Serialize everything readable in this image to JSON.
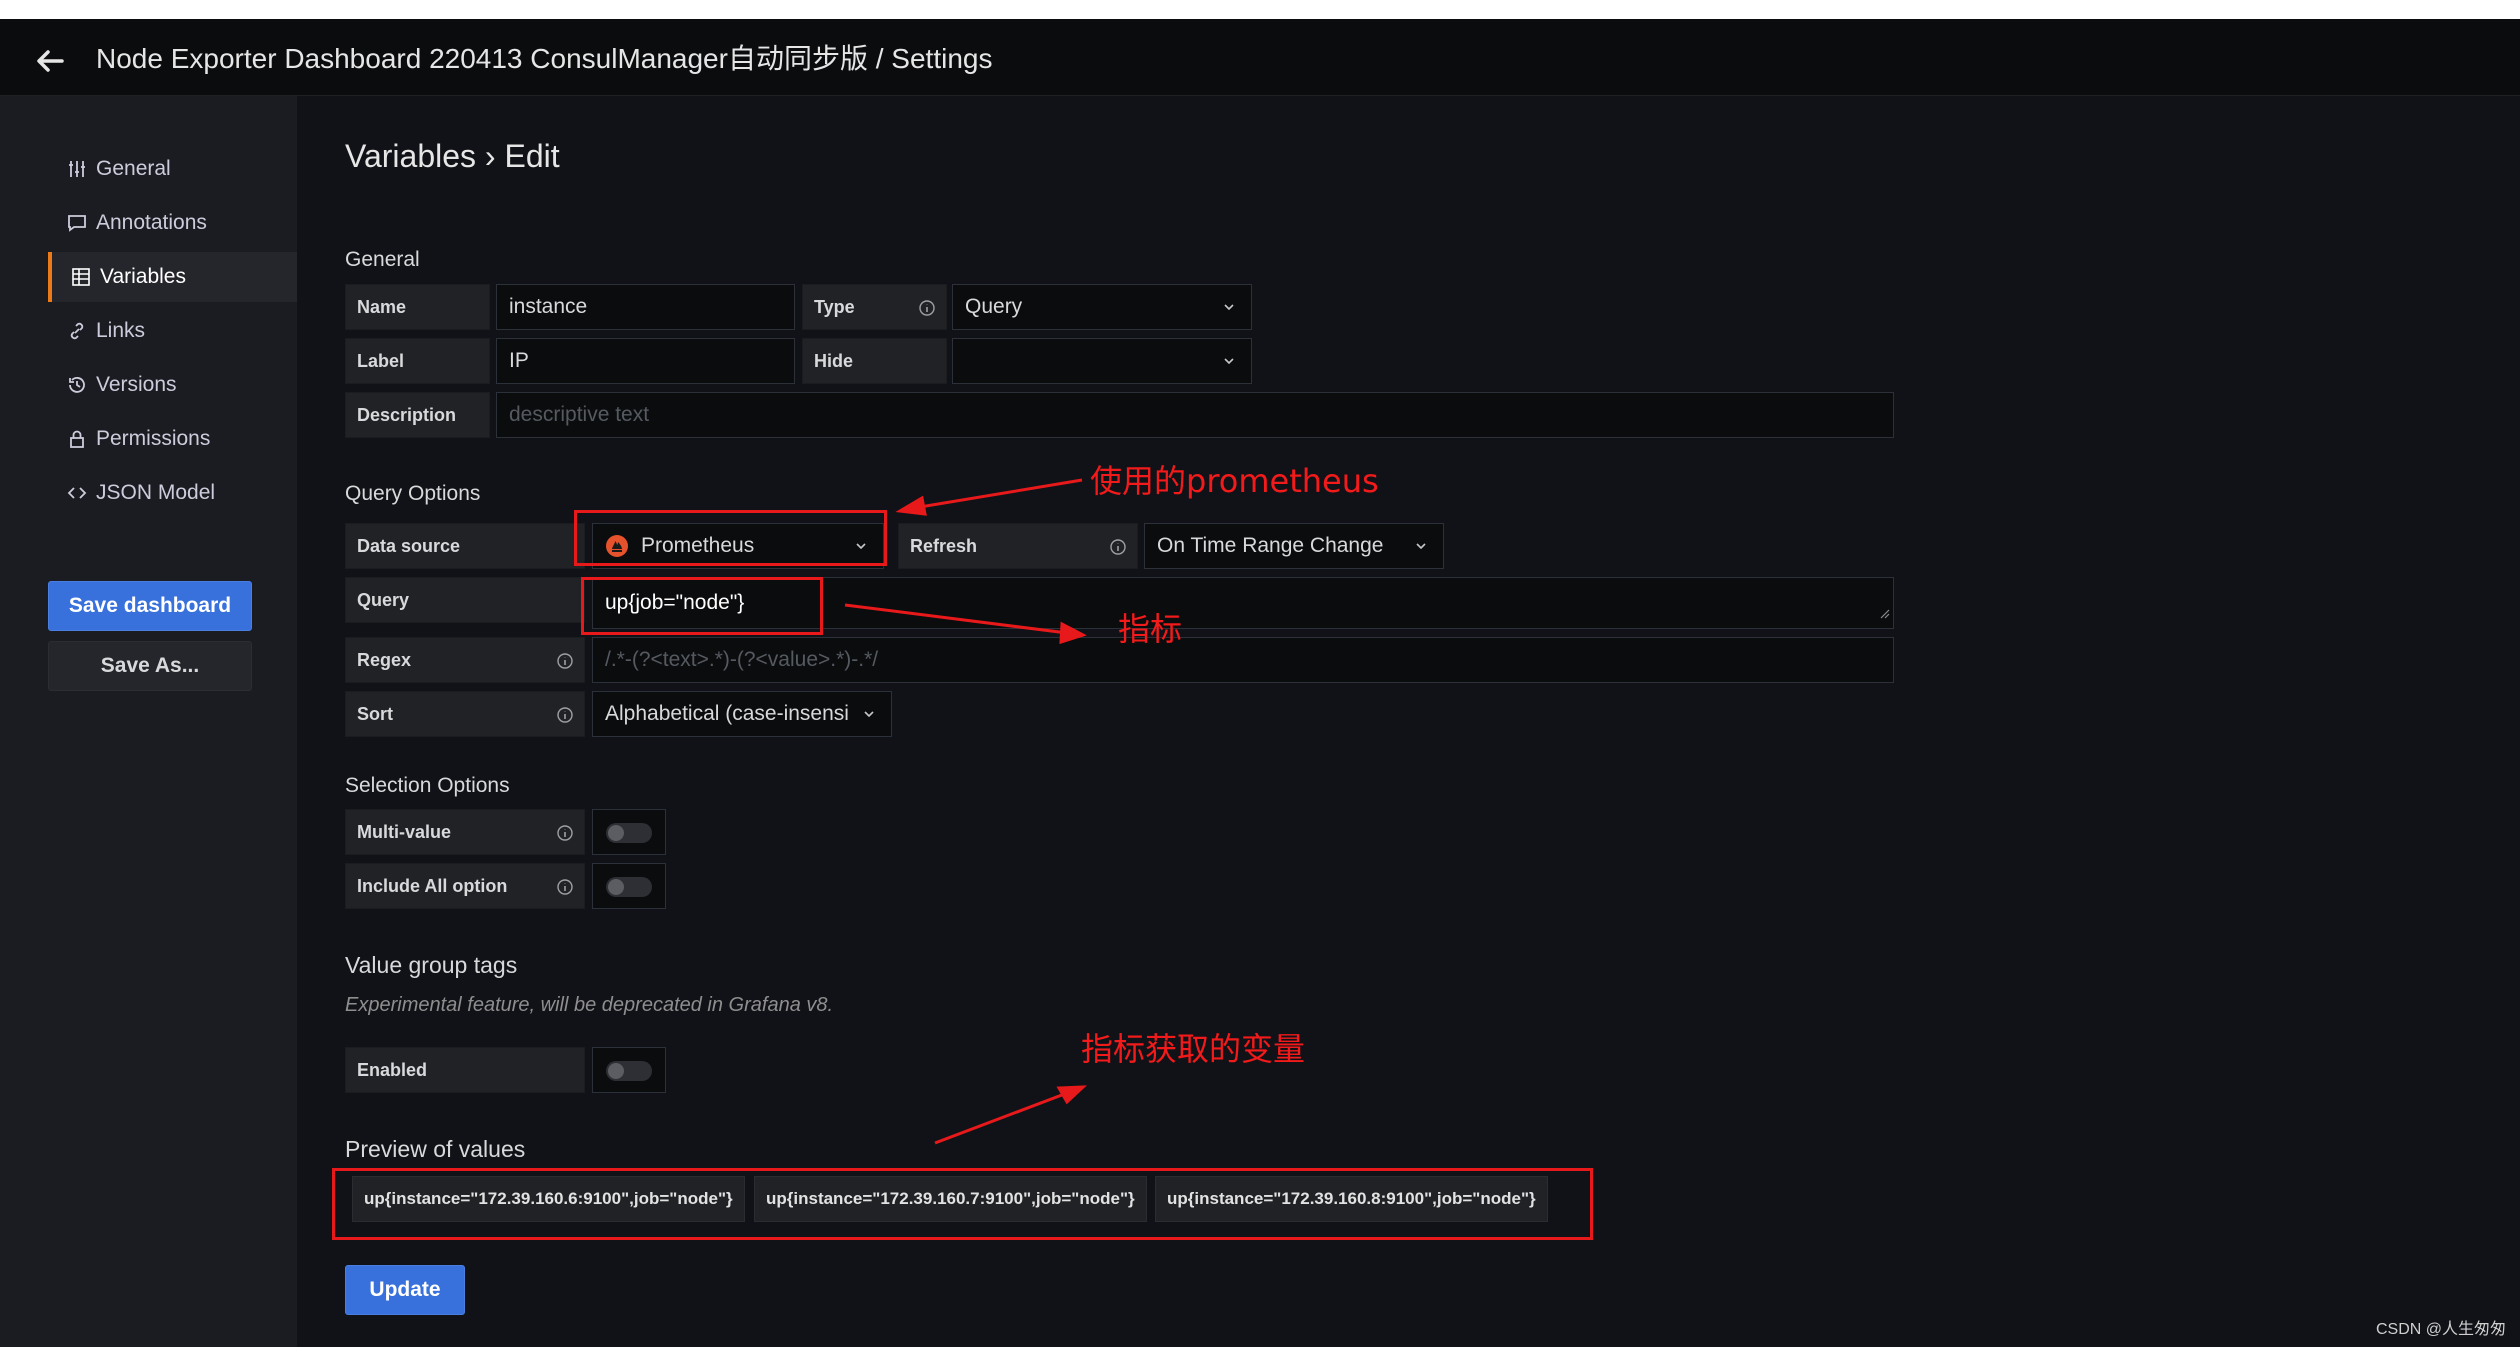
{
  "header": {
    "title": "Node Exporter Dashboard 220413 ConsulManager自动同步版 / Settings"
  },
  "sidebar": {
    "items": [
      {
        "label": "General",
        "icon": "sliders-icon",
        "active": false
      },
      {
        "label": "Annotations",
        "icon": "comment-icon",
        "active": false
      },
      {
        "label": "Variables",
        "icon": "table-icon",
        "active": true
      },
      {
        "label": "Links",
        "icon": "link-icon",
        "active": false
      },
      {
        "label": "Versions",
        "icon": "history-icon",
        "active": false
      },
      {
        "label": "Permissions",
        "icon": "lock-icon",
        "active": false
      },
      {
        "label": "JSON Model",
        "icon": "code-icon",
        "active": false
      }
    ],
    "save_dashboard": "Save dashboard",
    "save_as": "Save As..."
  },
  "page": {
    "heading": "Variables › Edit"
  },
  "general": {
    "title": "General",
    "name_label": "Name",
    "name_value": "instance",
    "type_label": "Type",
    "type_value": "Query",
    "label_label": "Label",
    "label_value": "IP",
    "hide_label": "Hide",
    "hide_value": "",
    "description_label": "Description",
    "description_placeholder": "descriptive text"
  },
  "query_options": {
    "title": "Query Options",
    "datasource_label": "Data source",
    "datasource_value": "Prometheus",
    "refresh_label": "Refresh",
    "refresh_value": "On Time Range Change",
    "query_label": "Query",
    "query_value": "up{job=\"node\"}",
    "regex_label": "Regex",
    "regex_placeholder": "/.*-(?<text>.*)-(?<value>.*)-.*/",
    "sort_label": "Sort",
    "sort_value": "Alphabetical (case-insensi"
  },
  "selection_options": {
    "title": "Selection Options",
    "multi_label": "Multi-value",
    "include_all_label": "Include All option",
    "multi_value": false,
    "include_all": false
  },
  "value_group_tags": {
    "title": "Value group tags",
    "note": "Experimental feature, will be deprecated in Grafana v8.",
    "enabled_label": "Enabled",
    "enabled": false
  },
  "preview": {
    "title": "Preview of values",
    "values": [
      "up{instance=\"172.39.160.6:9100\",job=\"node\"}",
      "up{instance=\"172.39.160.7:9100\",job=\"node\"}",
      "up{instance=\"172.39.160.8:9100\",job=\"node\"}"
    ]
  },
  "update_button": "Update",
  "annotations": {
    "datasource_note": "使用的prometheus",
    "query_note": "指标",
    "preview_note": "指标获取的变量",
    "color": "#e8191a"
  },
  "watermark": "CSDN @人生匆匆",
  "colors": {
    "primary": "#3871dc",
    "active_accent": "#eb7b18"
  }
}
